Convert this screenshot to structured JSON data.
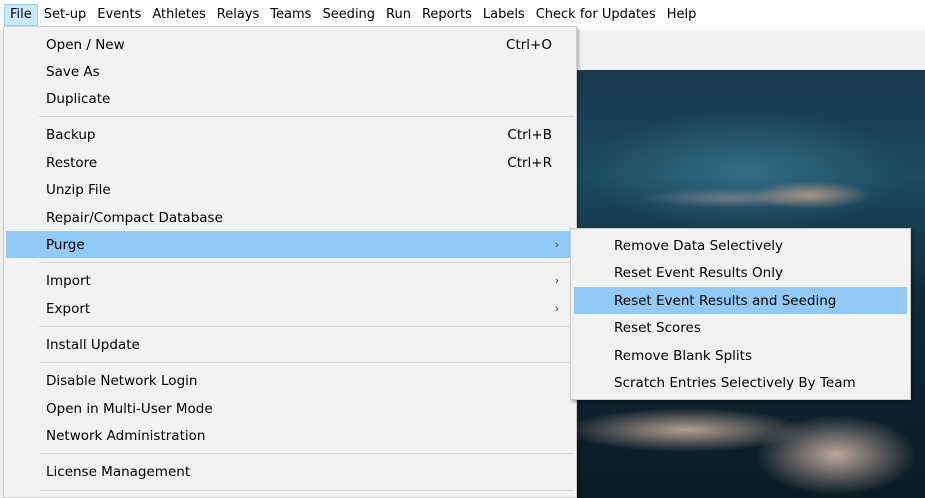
{
  "menubar": {
    "items": [
      {
        "label": "File",
        "open": true
      },
      {
        "label": "Set-up"
      },
      {
        "label": "Events"
      },
      {
        "label": "Athletes"
      },
      {
        "label": "Relays"
      },
      {
        "label": "Teams"
      },
      {
        "label": "Seeding"
      },
      {
        "label": "Run"
      },
      {
        "label": "Reports"
      },
      {
        "label": "Labels"
      },
      {
        "label": "Check for Updates"
      },
      {
        "label": "Help"
      }
    ]
  },
  "file_menu": {
    "items": [
      {
        "label": "Open / New",
        "shortcut": "Ctrl+O"
      },
      {
        "label": "Save As"
      },
      {
        "label": "Duplicate"
      },
      {
        "label": "Backup",
        "shortcut": "Ctrl+B"
      },
      {
        "label": "Restore",
        "shortcut": "Ctrl+R"
      },
      {
        "label": "Unzip File"
      },
      {
        "label": "Repair/Compact Database"
      },
      {
        "label": "Purge",
        "submenu": true,
        "highlighted": true
      },
      {
        "label": "Import",
        "submenu": true
      },
      {
        "label": "Export",
        "submenu": true
      },
      {
        "label": "Install Update"
      },
      {
        "label": "Disable Network Login"
      },
      {
        "label": "Open in Multi-User Mode"
      },
      {
        "label": "Network Administration"
      },
      {
        "label": "License Management"
      }
    ],
    "arrow_glyph": "›"
  },
  "purge_submenu": {
    "items": [
      {
        "label": "Remove Data Selectively"
      },
      {
        "label": "Reset Event Results Only"
      },
      {
        "label": "Reset Event Results and Seeding",
        "highlighted": true
      },
      {
        "label": "Reset Scores"
      },
      {
        "label": "Remove Blank Splits"
      },
      {
        "label": "Scratch Entries Selectively By Team"
      }
    ]
  },
  "colors": {
    "highlight": "#91c9f7",
    "menu_bg": "#f2f2f2",
    "menubar_open": "#cce8ff"
  }
}
